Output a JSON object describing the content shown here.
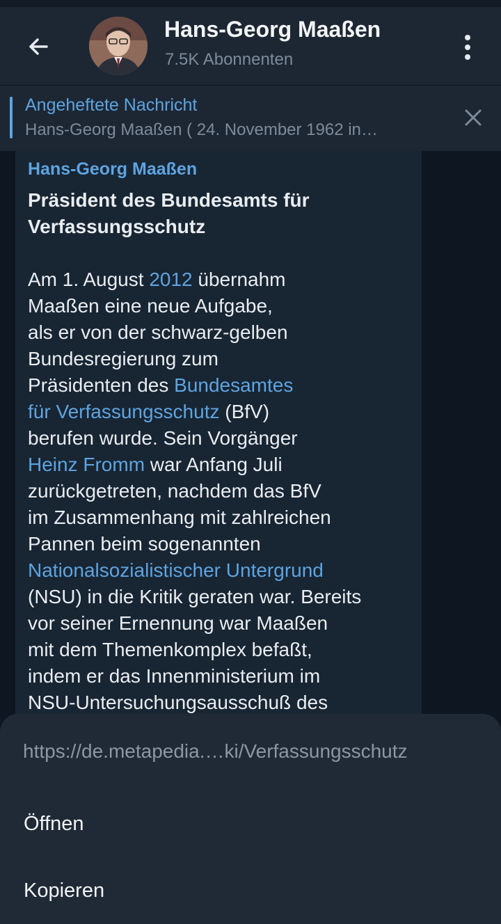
{
  "header": {
    "channel_name": "Hans-Georg Maaßen",
    "subscribers": "7.5K Abonnenten",
    "back_icon": "arrow-left-icon",
    "more_icon": "more-vertical-icon"
  },
  "pinned": {
    "label": "Angeheftete Nachricht",
    "preview": "Hans-Georg Maaßen ( 24. November 1962 in…"
  },
  "message": {
    "author": "Hans-Georg Maaßen",
    "heading_lines": [
      "Präsident des Bundesamts für",
      "Verfassungsschutz"
    ],
    "body": {
      "l1_a": "Am 1. August ",
      "l1_link": "2012",
      "l1_b": " übernahm",
      "l2": "Maaßen eine neue Aufgabe,",
      "l3": "als er von der schwarz-gelben",
      "l4": "Bundesregierung zum",
      "l5_a": "Präsidenten des ",
      "l5_link": "Bundesamtes",
      "l6_link": "für Verfassungsschutz",
      "l6_b": " (BfV)",
      "l7": "berufen wurde. Sein Vorgänger",
      "l8_link": "Heinz Fromm",
      "l8_b": " war Anfang Juli",
      "l9": "zurückgetreten, nachdem das BfV",
      "l10": "im Zusammenhang mit zahlreichen",
      "l11": "Pannen beim sogenannten",
      "l12_link": "Nationalsozialistischer Untergrund",
      "l13": "(NSU) in die Kritik geraten war. Bereits",
      "l14": "vor seiner Ernennung war Maaßen",
      "l15": "mit dem Themenkomplex befaßt,",
      "l16": "indem er das Innenministerium im",
      "l17": "NSU-Untersuchungsausschuß des"
    }
  },
  "sheet": {
    "url": "https://de.metapedia.…ki/Verfassungsschutz",
    "open_label": "Öffnen",
    "copy_label": "Kopieren"
  },
  "colors": {
    "background": "#0e1621",
    "header": "#1d2733",
    "bubble": "#182533",
    "sheet": "#1f2a36",
    "accent_link": "#5ea4e0"
  }
}
